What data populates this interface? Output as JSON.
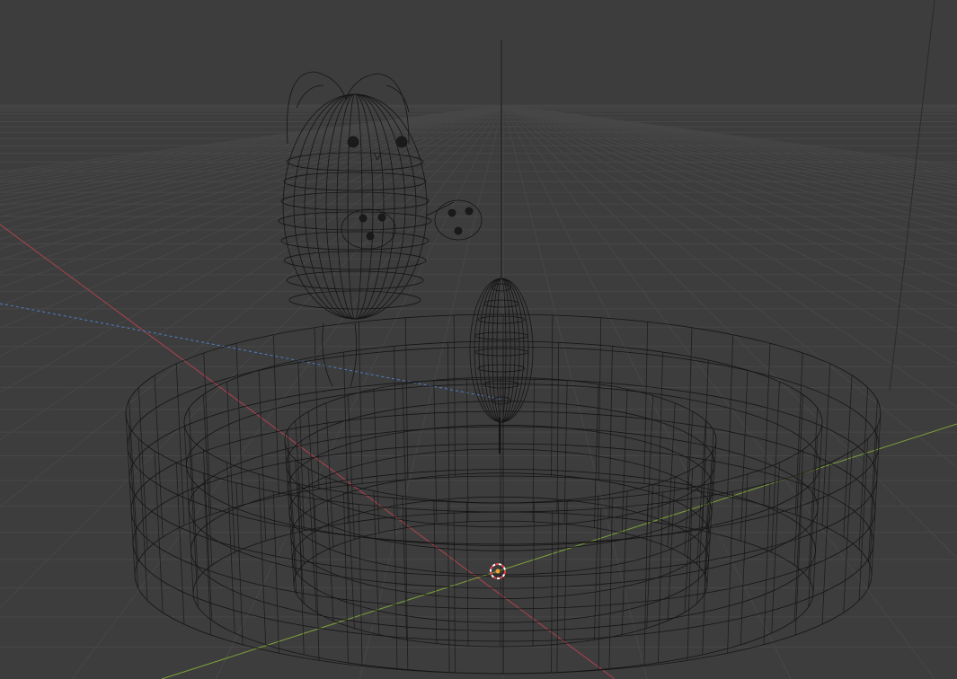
{
  "viewport": {
    "mode": "wireframe",
    "background_color": "#3d3d3d",
    "grid_color": "#4a4a4a",
    "wire_color": "#111111",
    "axis_x_color": "#b0424f",
    "axis_y_color": "#7ea13a",
    "axis_z_color": "#4f7fc8"
  },
  "objects": [
    {
      "name": "cat",
      "icon": "cat-mesh"
    },
    {
      "name": "candle-flame",
      "icon": "flame-mesh"
    },
    {
      "name": "outer-bowl",
      "icon": "cylinder-mesh"
    },
    {
      "name": "inner-cylinder",
      "icon": "cylinder-mesh"
    }
  ],
  "cursor": {
    "icon": "3d-cursor-icon"
  }
}
